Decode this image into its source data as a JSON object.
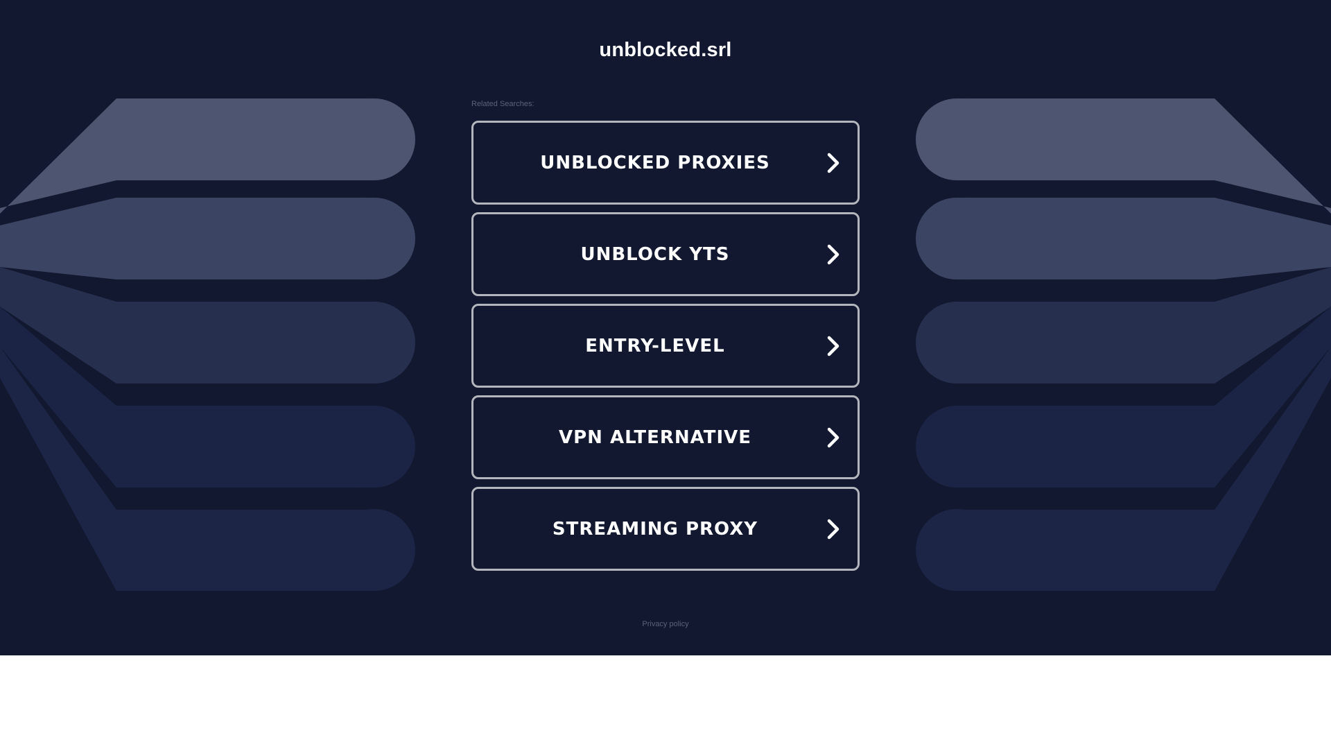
{
  "header": {
    "domain": "unblocked.srl"
  },
  "related": {
    "label": "Related Searches:",
    "items": [
      {
        "label": "UNBLOCKED PROXIES"
      },
      {
        "label": "UNBLOCK YTS"
      },
      {
        "label": "ENTRY-LEVEL"
      },
      {
        "label": "VPN ALTERNATIVE"
      },
      {
        "label": "STREAMING PROXY"
      }
    ]
  },
  "footer": {
    "privacy_label": "Privacy policy"
  },
  "colors": {
    "background": "#121830",
    "button_border": "#b4b6bd",
    "band_1": "#4d5571",
    "band_2": "#3b4462",
    "band_3": "#262f4e",
    "band_4": "#1b2444",
    "band_5": "#1c2546"
  },
  "icons": {
    "item_arrow": "chevron-right-icon"
  }
}
